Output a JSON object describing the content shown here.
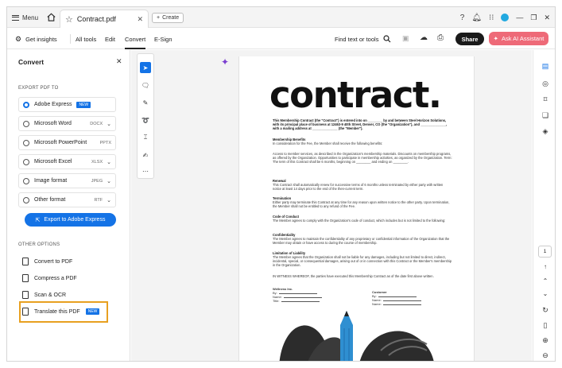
{
  "titlebar": {
    "menu_label": "Menu",
    "tab_title": "Contract.pdf",
    "create_label": "Create"
  },
  "toolbar": {
    "get_insights": "Get insights",
    "items": [
      "All tools",
      "Edit",
      "Convert",
      "E-Sign"
    ],
    "active_item": "Convert",
    "find_label": "Find text or tools",
    "share_label": "Share",
    "ai_label": "Ask AI Assistant"
  },
  "panel": {
    "title": "Convert",
    "export_label": "EXPORT PDF TO",
    "options": [
      {
        "label": "Adobe Express",
        "badge": "NEW",
        "format": "",
        "selected": true
      },
      {
        "label": "Microsoft Word",
        "badge": "",
        "format": "DOCX",
        "selected": false
      },
      {
        "label": "Microsoft PowerPoint",
        "badge": "",
        "format": "PPTX",
        "selected": false
      },
      {
        "label": "Microsoft Excel",
        "badge": "",
        "format": "XLSX",
        "selected": false
      },
      {
        "label": "Image format",
        "badge": "",
        "format": "JPEG",
        "selected": false
      },
      {
        "label": "Other format",
        "badge": "",
        "format": "RTF",
        "selected": false
      }
    ],
    "export_button": "Export to Adobe Express",
    "other_label": "OTHER OPTIONS",
    "other_options": [
      {
        "label": "Convert to PDF",
        "badge": ""
      },
      {
        "label": "Compress a PDF",
        "badge": ""
      },
      {
        "label": "Scan & OCR",
        "badge": ""
      },
      {
        "label": "Translate this PDF",
        "badge": "NEW"
      }
    ]
  },
  "document": {
    "heading": "contract.",
    "intro": "This Membership Contract (the \"Contract\") is entered into on ________ by and between Steel Horizon Solutions, with its principal place of business at 12463-9 40th Street, Denver, CO (the \"Organization\"), and ______________, with a mailing address at ______________ (the \"Member\").",
    "sections": [
      {
        "title": "Membership Benefits",
        "text": "In consideration for the Fee, the Member shall receive the following benefits:"
      },
      {
        "title": "",
        "text": "Access to member services, as described in the Organization's membership materials. Discounts on membership programs, as offered by the Organization. Opportunities to participate in membership activities, as organized by the Organization. Term: The term of this Contract shall be 6 months, beginning on ________ and ending on ________."
      },
      {
        "title": "Renewal",
        "text": "This Contract shall automatically renew for successive terms of 6 months unless terminated by either party with written notice at least 14 days prior to the end of the then-current term."
      },
      {
        "title": "Termination",
        "text": "Either party may terminate this Contract at any time for any reason upon written notice to the other party. Upon termination, the Member shall not be entitled to any refund of the Fee."
      },
      {
        "title": "Code of Conduct",
        "text": "The Member agrees to comply with the Organization's code of conduct, which includes but is not limited to the following:"
      },
      {
        "title": "Confidentiality",
        "text": "The Member agrees to maintain the confidentiality of any proprietary or confidential information of the Organization that the Member may obtain or have access to during the course of membership."
      },
      {
        "title": "Limitation of Liability",
        "text": "The Member agrees that the Organization shall not be liable for any damages, including but not limited to direct, indirect, incidental, special, or consequential damages, arising out of or in connection with this Contract or the Member's membership in the Organization."
      },
      {
        "title": "",
        "text": "IN WITNESS WHEREOF, the parties have executed this Membership Contract as of the date first above written."
      }
    ],
    "sig_left": {
      "title": "Wellness Inc.",
      "fields": [
        "By:",
        "Name:",
        "Title:"
      ]
    },
    "sig_right": {
      "title": "Customer",
      "fields": [
        "By:",
        "Name:",
        "Name:"
      ]
    }
  },
  "rail": {
    "page_number": "1"
  },
  "colors": {
    "accent": "#1473e6",
    "ai_button": "#ee6a78",
    "highlight": "#e8a020",
    "art_blue": "#2f8fd1"
  }
}
